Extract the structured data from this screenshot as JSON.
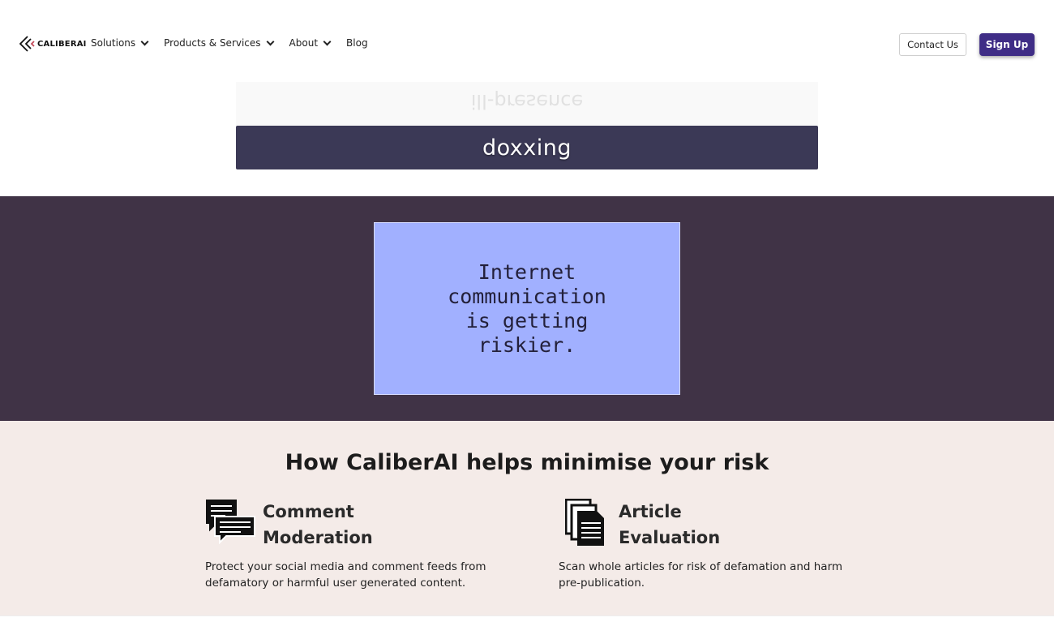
{
  "nav": {
    "logo_text": "CALIBERAI",
    "menu": [
      {
        "label": "Solutions",
        "has_dropdown": true
      },
      {
        "label": "Products & Services",
        "has_dropdown": true
      },
      {
        "label": "About",
        "has_dropdown": true
      },
      {
        "label": "Blog",
        "has_dropdown": false
      }
    ],
    "contact_label": "Contact Us",
    "signup_label": "Sign Up"
  },
  "roller": {
    "previous_word": "ill-presence",
    "active_word": "doxxing"
  },
  "hero": {
    "card_text": "Internet communication is getting riskier."
  },
  "risk": {
    "title": "How CaliberAI helps minimise your risk",
    "features": [
      {
        "icon": "chat-bubbles-icon",
        "title": "Comment Moderation",
        "description": "Protect your social media and comment feeds from defamatory or harmful user generated content."
      },
      {
        "icon": "documents-icon",
        "title": "Article Evaluation",
        "description": "Scan whole articles for risk of defamation and harm pre-publication."
      }
    ]
  },
  "colors": {
    "signup_bg": "#3f2d86",
    "active_word_bg": "#3b3956",
    "dark_band_bg": "#403346",
    "card_bg": "#a1b0ff",
    "risk_bg": "#f4ebe8"
  }
}
